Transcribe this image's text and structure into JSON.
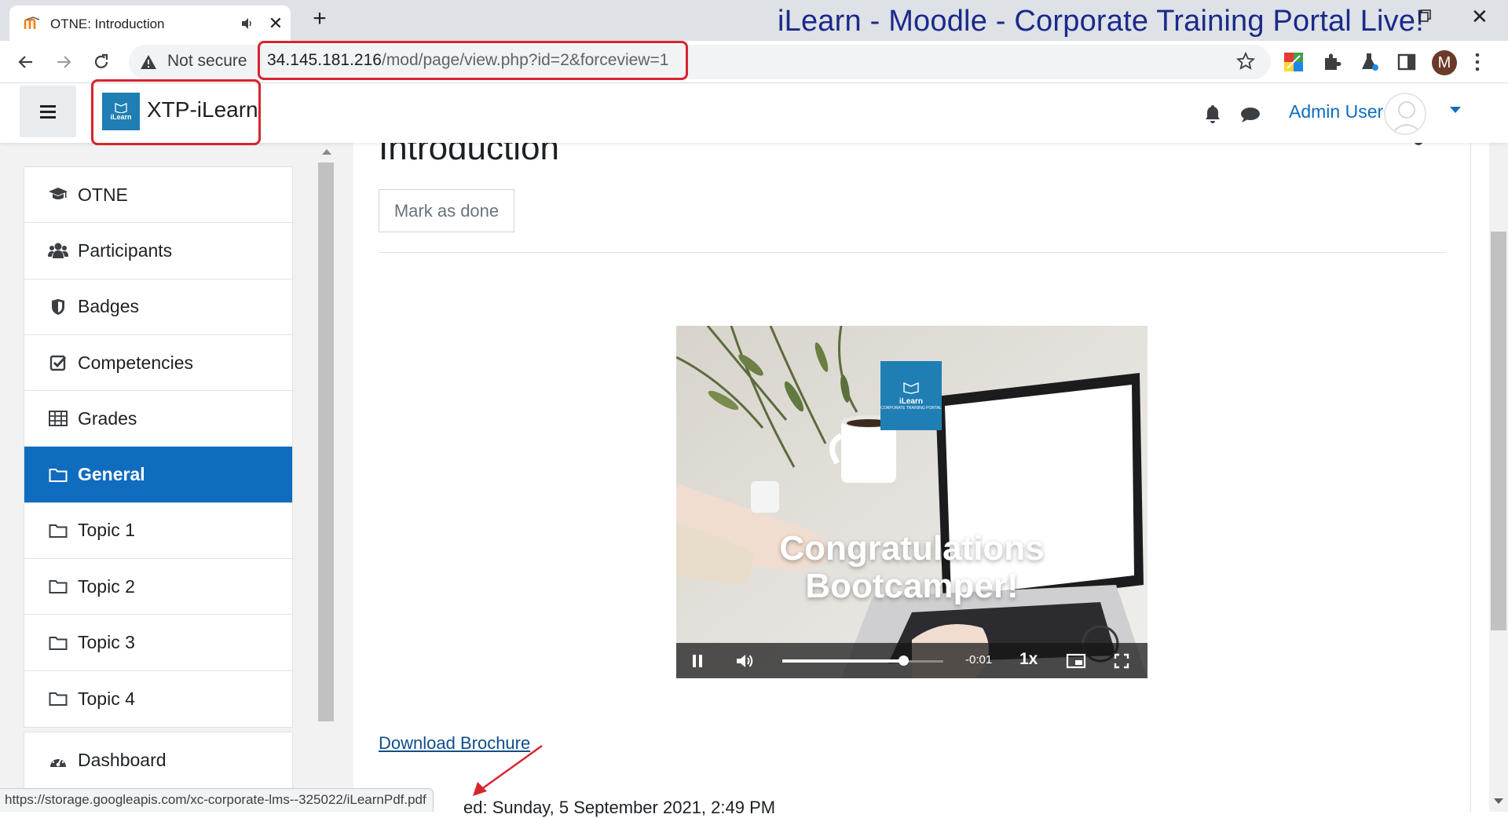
{
  "browser": {
    "tab_title": "OTNE: Introduction",
    "tab_close": "✕",
    "new_tab": "+",
    "window_title": "iLearn - Moodle - Corporate Training Portal Live!",
    "win_close": "✕",
    "security_label": "Not secure",
    "url_host": "34.145.181.216",
    "url_path": "/mod/page/view.php?id=2&forceview=1",
    "profile_initial": "M",
    "status_url": "https://storage.googleapis.com/xc-corporate-lms--325022/iLearnPdf.pdf"
  },
  "navbar": {
    "brand_name": "XTP-iLearn",
    "brand_logo_text": "iLearn",
    "user_name": "Admin User"
  },
  "drawer": {
    "course_items": [
      {
        "label": "OTNE",
        "icon": "graduation-cap-icon"
      },
      {
        "label": "Participants",
        "icon": "users-icon"
      },
      {
        "label": "Badges",
        "icon": "shield-icon"
      },
      {
        "label": "Competencies",
        "icon": "check-square-icon"
      },
      {
        "label": "Grades",
        "icon": "table-icon"
      },
      {
        "label": "General",
        "icon": "folder-icon",
        "active": true
      },
      {
        "label": "Topic 1",
        "icon": "folder-icon"
      },
      {
        "label": "Topic 2",
        "icon": "folder-icon"
      },
      {
        "label": "Topic 3",
        "icon": "folder-icon"
      },
      {
        "label": "Topic 4",
        "icon": "folder-icon"
      }
    ],
    "site_items": [
      {
        "label": "Dashboard",
        "icon": "dashboard-icon"
      }
    ]
  },
  "main": {
    "heading": "Introduction",
    "mark_done_label": "Mark as done",
    "video": {
      "overlay_text_line1": "Congratulations",
      "overlay_text_line2": "Bootcamper!",
      "logo_text": "iLearn",
      "logo_subtext": "CORPORATE TRAINING PORTAL",
      "time_remaining": "-0:01",
      "speed": "1x",
      "progress": 0.75
    },
    "download_link": "Download Brochure",
    "modified_text": "ed: Sunday, 5 September 2021, 2:49 PM"
  },
  "colors": {
    "primary": "#0f6cbf",
    "annotation_red": "#d8242f",
    "title_blue": "#1a2a8a"
  }
}
